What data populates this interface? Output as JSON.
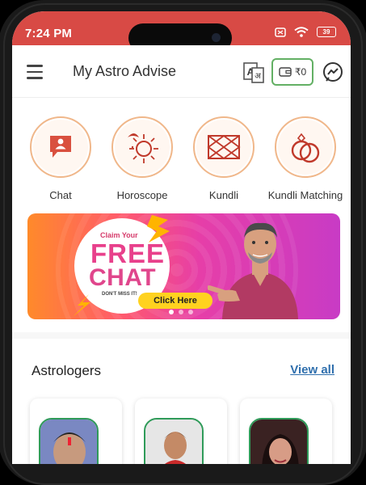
{
  "status": {
    "time": "7:24 PM",
    "battery": "39"
  },
  "appbar": {
    "title": "My Astro Advise",
    "wallet_amount": "₹0"
  },
  "services": [
    {
      "label": "Chat",
      "icon": "chat-icon"
    },
    {
      "label": "Horoscope",
      "icon": "horoscope-icon"
    },
    {
      "label": "Kundli",
      "icon": "kundli-icon"
    },
    {
      "label": "Kundli Matching",
      "icon": "rings-icon"
    }
  ],
  "banner": {
    "claim": "Claim Your",
    "free": "FREE",
    "chat": "CHAT",
    "dont_miss": "DON'T MISS IT!",
    "cta": "Click Here",
    "dots": 3,
    "active_dot": 0
  },
  "astrologers": {
    "title": "Astrologers",
    "view_all": "View all"
  },
  "colors": {
    "status_bar": "#d84a45",
    "accent_orange": "#f0b78a",
    "wallet_border": "#63b064",
    "link": "#2f6fad"
  }
}
